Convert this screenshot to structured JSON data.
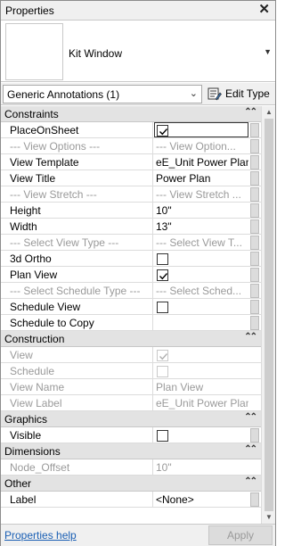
{
  "window": {
    "title": "Properties"
  },
  "type_selector": {
    "type_name": "Kit Window"
  },
  "filter": {
    "selected": "Generic Annotations (1)",
    "edit_type_label": "Edit Type"
  },
  "sections": {
    "constraints": "Constraints",
    "construction": "Construction",
    "graphics": "Graphics",
    "dimensions": "Dimensions",
    "other": "Other"
  },
  "rows": {
    "place_on_sheet": {
      "name": "PlaceOnSheet",
      "checked": true
    },
    "view_options": {
      "name": "---   View Options   ---",
      "value": "---   View Option..."
    },
    "view_template": {
      "name": "View Template",
      "value": "eE_Unit Power Plan"
    },
    "view_title": {
      "name": "View Title",
      "value": "Power Plan"
    },
    "view_stretch": {
      "name": "---   View Stretch   ---",
      "value": "---   View Stretch ..."
    },
    "height": {
      "name": "Height",
      "value": "10\""
    },
    "width": {
      "name": "Width",
      "value": "13\""
    },
    "select_view_type": {
      "name": "---   Select View Type   ---",
      "value": "---   Select View T..."
    },
    "ortho_3d": {
      "name": "3d Ortho",
      "checked": false
    },
    "plan_view": {
      "name": "Plan View",
      "checked": true
    },
    "select_schedule_type": {
      "name": "---   Select Schedule Type   ---",
      "value": "---   Select Sched..."
    },
    "schedule_view": {
      "name": "Schedule View",
      "checked": false
    },
    "schedule_to_copy": {
      "name": "Schedule to Copy",
      "value": ""
    },
    "view": {
      "name": "View",
      "checked": true
    },
    "schedule": {
      "name": "Schedule",
      "checked": false
    },
    "view_name": {
      "name": "View Name",
      "value": "Plan View"
    },
    "view_label": {
      "name": "View Label",
      "value": "eE_Unit Power Plan"
    },
    "visible": {
      "name": "Visible",
      "checked": false
    },
    "node_offset": {
      "name": "Node_Offset",
      "value": "10\""
    },
    "label": {
      "name": "Label",
      "value": "<None>"
    }
  },
  "footer": {
    "help_link": "Properties help",
    "apply_label": "Apply"
  },
  "colors": {
    "section_bg": "#e3e3e3",
    "link": "#1a5fb4",
    "disabled_text": "#9a9a9a"
  },
  "icons": [
    "close-icon",
    "dropdown-arrow-icon",
    "edit-type-icon",
    "checkbox-icon",
    "collapse-section-icon",
    "scroll-up-icon",
    "scroll-down-icon"
  ]
}
